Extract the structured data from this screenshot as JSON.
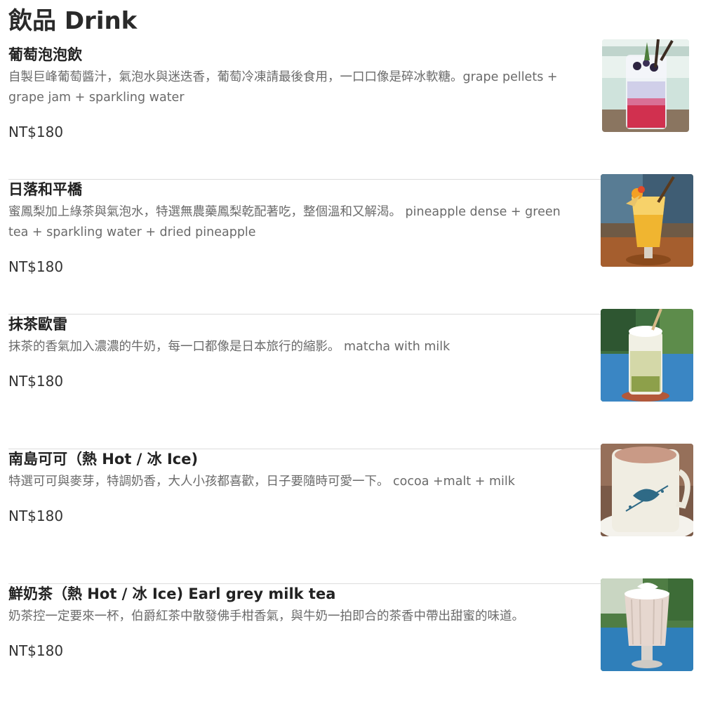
{
  "page": {
    "title": "飲品 Drink"
  },
  "items": [
    {
      "name": "葡萄泡泡飲",
      "description": "自製巨峰葡萄醬汁，氣泡水與迷迭香，葡萄冷凍請最後食用，一口口像是碎冰軟糖。grape pellets + grape jam + sparkling water",
      "price": "NT$180",
      "photo": "grape-sparkling-drink-photo"
    },
    {
      "name": "日落和平橋",
      "description": "蜜鳳梨加上綠茶與氣泡水，特選無農藥鳳梨乾配著吃，整個溫和又解渴。 pineapple dense + green tea + sparkling water + dried pineapple",
      "price": "NT$180",
      "photo": "pineapple-tea-drink-photo"
    },
    {
      "name": "抹茶歐雷",
      "description": "抹茶的香氣加入濃濃的牛奶，每一口都像是日本旅行的縮影。 matcha with milk",
      "price": "NT$180",
      "photo": "matcha-latte-photo"
    },
    {
      "name": "南島可可（熱 Hot / 冰 Ice)",
      "description": "特選可可與麥芽，特調奶香，大人小孩都喜歡，日子要隨時可愛一下。 cocoa +malt + milk",
      "price": "NT$180",
      "photo": "hot-cocoa-mug-photo"
    },
    {
      "name": "鮮奶茶（熱 Hot / 冰 Ice) Earl grey milk tea",
      "description": "奶茶控一定要來一杯，伯爵紅茶中散發佛手柑香氣，與牛奶一拍即合的茶香中帶出甜蜜的味道。",
      "price": "NT$180",
      "photo": "earl-grey-milk-tea-photo"
    }
  ]
}
